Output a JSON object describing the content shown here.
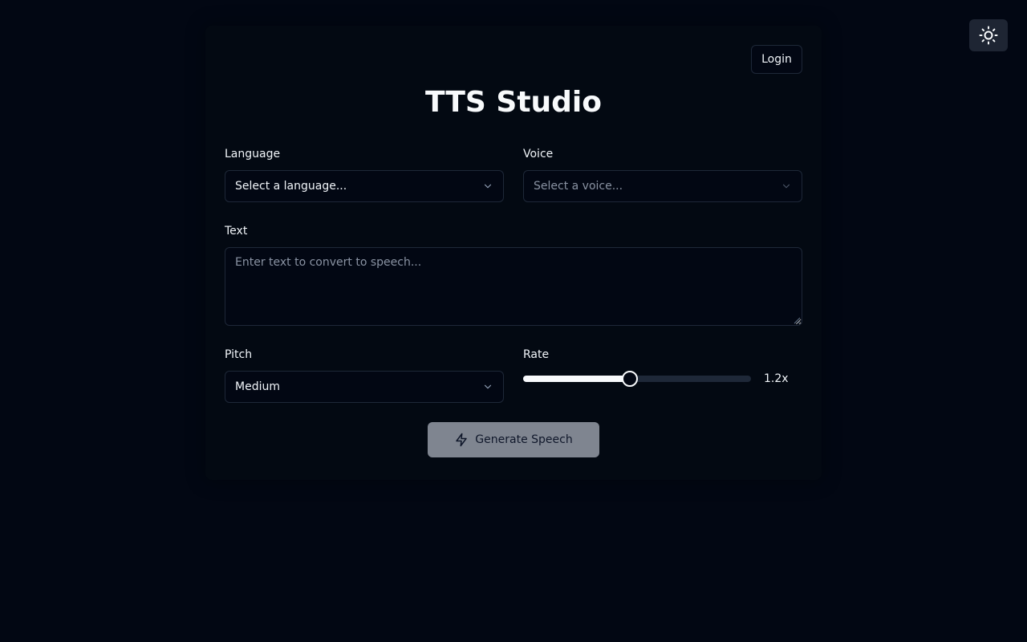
{
  "header": {
    "login_label": "Login",
    "theme_icon": "sun-icon"
  },
  "title": "TTS Studio",
  "form": {
    "language": {
      "label": "Language",
      "value": "Select a language..."
    },
    "voice": {
      "label": "Voice",
      "placeholder": "Select a voice...",
      "disabled": true
    },
    "text": {
      "label": "Text",
      "placeholder": "Enter text to convert to speech..."
    },
    "pitch": {
      "label": "Pitch",
      "value": "Medium"
    },
    "rate": {
      "label": "Rate",
      "value_label": "1.2x",
      "fraction": 0.47
    },
    "generate": {
      "label": "Generate Speech",
      "icon": "zap-icon",
      "disabled": true
    }
  },
  "colors": {
    "background": "#020713",
    "border": "#1e2838",
    "button_disabled": "#7f8590"
  }
}
